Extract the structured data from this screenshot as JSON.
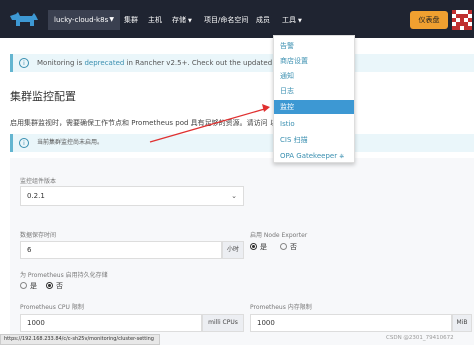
{
  "header": {
    "cluster_name": "lucky-cloud-k8s",
    "nav": [
      {
        "label": "集群"
      },
      {
        "label": "主机"
      },
      {
        "label": "存储"
      },
      {
        "label": "项目/命名空间"
      },
      {
        "label": "成员"
      },
      {
        "label": "工具"
      }
    ],
    "action_button": "仪表盘",
    "logo_icon": "rancher-cow-icon",
    "avatar_icon": "identicon-avatar"
  },
  "banner": {
    "prefix": "Monitoring is ",
    "link": "deprecated",
    "suffix": " in Rancher v2.5+. Check out the updated version of"
  },
  "page": {
    "title": "集群监控配置",
    "description": "启用集群监视时，需要确保工作节点和 Prometheus pod 具有足够的资源。请访问                    以获取有关资源限制。"
  },
  "notice": {
    "text": "当前集群监控尚未启用。"
  },
  "form": {
    "monitor_version_label": "监控组件版本",
    "monitor_version_value": "0.2.1",
    "retention_label": "数据保存时间",
    "retention_value": "6",
    "retention_unit": "小时",
    "node_exporter_label": "启用 Node Exporter",
    "node_exporter_yes": "是",
    "node_exporter_no": "否",
    "persist_label": "为 Prometheus 启用持久化存储",
    "persist_yes": "是",
    "persist_no": "否",
    "cpu_label": "Prometheus CPU 限制",
    "cpu_value": "1000",
    "cpu_unit": "milli CPUs",
    "mem_label": "Prometheus 内存限制",
    "mem_value": "1000",
    "mem_unit": "MiB"
  },
  "tools_menu": {
    "items": [
      {
        "label": "告警"
      },
      {
        "label": "商店设置"
      },
      {
        "label": "通知"
      },
      {
        "label": "日志"
      },
      {
        "label": "监控"
      },
      {
        "label": "Istio"
      },
      {
        "label": "CIS 扫描"
      },
      {
        "label": "OPA Gatekeeper",
        "icon": "kubernetes-icon"
      }
    ],
    "active": "监控"
  },
  "statusbar": {
    "url": "https://192.168.233.84/c/c-sh25v/monitoring/cluster-setting"
  },
  "watermark": "CSDN @2301_79410672",
  "colors": {
    "topbar": "#1f2431",
    "accent": "#3d98d3",
    "button": "#f0a030",
    "arrow": "#e03030"
  }
}
